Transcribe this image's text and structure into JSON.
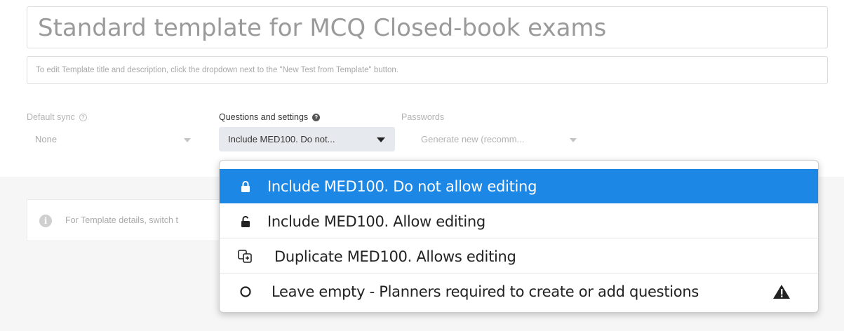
{
  "template": {
    "title": "Standard template for MCQ Closed-book exams",
    "description": "To edit Template title and description, click the dropdown next to the \"New Test from Template\" button."
  },
  "fields": {
    "default_sync": {
      "label": "Default sync",
      "value": "None",
      "help": "?"
    },
    "questions_settings": {
      "label": "Questions and settings",
      "value": "Include MED100. Do not...",
      "help": "?"
    },
    "passwords": {
      "label": "Passwords",
      "value": "Generate new (recomm..."
    }
  },
  "info_card": {
    "icon": "i",
    "text": "For Template details, switch t"
  },
  "dropdown": {
    "options": [
      {
        "label": "Include MED100. Do not allow editing",
        "icon": "lock-icon",
        "selected": true
      },
      {
        "label": "Include MED100. Allow editing",
        "icon": "unlock-icon",
        "selected": false
      },
      {
        "label": "Duplicate MED100. Allows editing",
        "icon": "duplicate-icon",
        "selected": false
      },
      {
        "label": "Leave empty - Planners required to create or add questions",
        "icon": "empty-circle-icon",
        "selected": false,
        "trailing_icon": "warning-icon"
      }
    ]
  },
  "colors": {
    "selected_bg": "#1c87e5",
    "select_bg": "#e6e9ee",
    "muted_text": "#b3b3b3"
  }
}
